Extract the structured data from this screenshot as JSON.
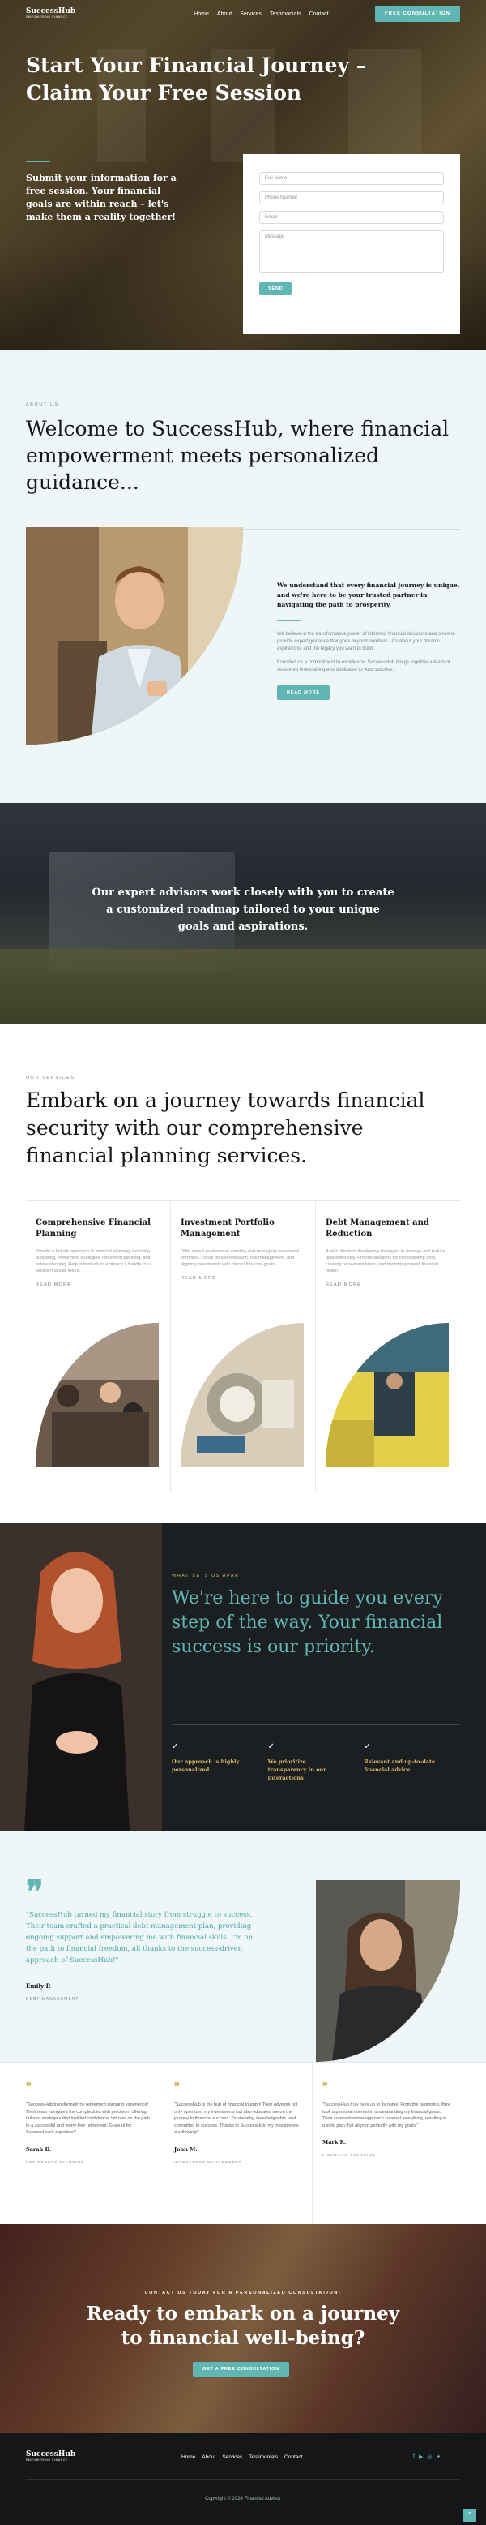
{
  "brand": {
    "name": "SuccessHub",
    "tagline": "EMPOWERING FINANCE"
  },
  "nav": {
    "items": [
      "Home",
      "About",
      "Services",
      "Testimonials",
      "Contact"
    ],
    "cta": "FREE CONSULTATION"
  },
  "hero": {
    "title": "Start Your Financial Journey – Claim Your Free Session",
    "lead": "Submit your information for a free session. Your financial goals are within reach – let's make them a reality together!",
    "form": {
      "full_name_placeholder": "Full Name",
      "phone_placeholder": "Phone Number",
      "email_placeholder": "Email",
      "message_placeholder": "Message",
      "submit": "SEND"
    }
  },
  "about": {
    "eyebrow": "ABOUT US",
    "heading": "Welcome to SuccessHub, where financial empowerment meets personalized guidance...",
    "bold": "We understand that every financial journey is unique, and we're here to be your trusted partner in navigating the path to prosperity.",
    "p1": "We believe in the transformative power of informed financial decisions and strive to provide expert guidance that goes beyond numbers - it's about your dreams, aspirations, and the legacy you want to build.",
    "p2": "Founded on a commitment to excellence, SuccessHub brings together a team of seasoned financial experts dedicated to your success.",
    "button": "READ MORE"
  },
  "banner": {
    "text": "Our expert advisors work closely with you to create a customized roadmap tailored to your unique goals and aspirations."
  },
  "services": {
    "eyebrow": "OUR SERVICES",
    "heading": "Embark on a journey towards financial security with our comprehensive financial planning services.",
    "cards": [
      {
        "title": "Comprehensive Financial Planning",
        "text": "Provide a holistic approach to financial planning, including budgeting, investment strategies, retirement planning, and estate planning. Help individuals to embrace a handle for a secure financial future.",
        "more": "READ MORE"
      },
      {
        "title": "Investment Portfolio Management",
        "text": "Offer expert guidance on creating and managing investment portfolios. Focus on diversification, risk management, and aligning investments with clients' financial goals.",
        "more": "READ MORE"
      },
      {
        "title": "Debt Management and Reduction",
        "text": "Assist clients in developing strategies to manage and reduce debt effectively. Provide solutions for consolidating debt, creating repayment plans, and improving overall financial health.",
        "more": "READ MORE"
      }
    ]
  },
  "mission": {
    "eyebrow": "WHAT SETS US APART",
    "heading": "We're here to guide you every step of the way. Your financial success is our priority.",
    "features": [
      "Our approach is highly personalized",
      "We prioritize transparency in our interactions",
      "Relevant and up-to-date financial advice"
    ]
  },
  "testimonial": {
    "quote": "\"SuccessHub turned my financial story from struggle to success. Their team crafted a practical debt management plan, providing ongoing support and empowering me with financial skills. I'm on the path to financial freedom, all thanks to the success-driven approach of SuccessHub!\"",
    "name": "Emily P.",
    "role": "DEBT MANAGEMENT"
  },
  "reviews": [
    {
      "text": "\"SuccessHub transformed my retirement planning experience! Their team navigated the complexities with precision, offering tailored strategies that instilled confidence. I'm now on the path to a successful and worry-free retirement. Grateful for SuccessHub's expertise!\"",
      "name": "Sarah D.",
      "role": "RETIREMENT PLANNING"
    },
    {
      "text": "\"SuccessHub is the hub of financial triumph! Their advisors not only optimized my investments but also educated me on the journey to financial success. Trustworthy, knowledgeable, and committed to success. Thanks to SuccessHub, my investments are thriving!\"",
      "name": "John M.",
      "role": "INVESTMENT MANAGEMENT"
    },
    {
      "text": "\"SuccessHub truly lives up to its name! From the beginning, they took a personal interest in understanding my financial goals. Their comprehensive approach covered everything, resulting in a solid plan that aligned perfectly with my goals.\"",
      "name": "Mark R.",
      "role": "FINANCIAL PLANNING"
    }
  ],
  "final": {
    "eyebrow": "CONTACT US TODAY FOR A PERSONALIZED CONSULTATION!",
    "heading": "Ready to embark on a journey to financial well-being?",
    "button": "GET A FREE CONSULTATION"
  },
  "footer": {
    "links": [
      "Home",
      "About",
      "Services",
      "Testimonials",
      "Contact"
    ],
    "copyright": "Copyright © 2024 Financial Advisor",
    "social": [
      "facebook-icon",
      "youtube-icon",
      "instagram-icon",
      "twitter-icon"
    ]
  },
  "colors": {
    "accent": "#5fb6b3",
    "gold": "#d9b862",
    "dark": "#1c1f22",
    "light_bg": "#eef6f8"
  }
}
